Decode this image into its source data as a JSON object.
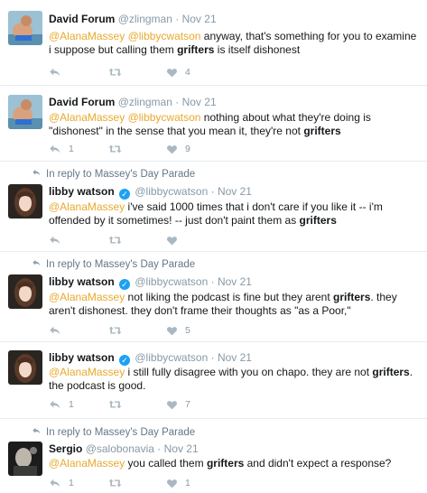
{
  "tweets": [
    {
      "name": "David Forum",
      "handle": "@zlingman",
      "dot": "·",
      "time": "Nov 21",
      "mentions": [
        "@AlanaMassey",
        "@libbycwatson"
      ],
      "text_a": " anyway, that's something for you to examine i suppose but calling them ",
      "strong": "grifters",
      "text_b": " is itself dishonest",
      "counts": {
        "reply": "",
        "retweet": "",
        "like": "4"
      }
    },
    {
      "name": "David Forum",
      "handle": "@zlingman",
      "dot": "·",
      "time": "Nov 21",
      "mentions": [
        "@AlanaMassey",
        "@libbycwatson"
      ],
      "text_a": " nothing about what they're doing is \"dishonest\" in the sense that you mean it, they're not ",
      "strong": "grifters",
      "text_b": "",
      "counts": {
        "reply": "1",
        "retweet": "",
        "like": "9"
      }
    },
    {
      "context": "In reply to Massey's Day Parade",
      "name": "libby watson",
      "handle": "@libbycwatson",
      "dot": "·",
      "time": "Nov 21",
      "mentions": [
        "@AlanaMassey"
      ],
      "text_a": " i've said 1000 times that i don't care if you like it -- i'm offended by it sometimes! -- just don't paint them as ",
      "strong": "grifters",
      "text_b": "",
      "counts": {
        "reply": "",
        "retweet": "",
        "like": ""
      }
    },
    {
      "context": "In reply to Massey's Day Parade",
      "name": "libby watson",
      "handle": "@libbycwatson",
      "dot": "·",
      "time": "Nov 21",
      "mentions": [
        "@AlanaMassey"
      ],
      "text_a": " not liking the podcast is fine but they arent ",
      "strong": "grifters",
      "text_b": ". they aren't dishonest. they don't frame their thoughts as \"as a Poor,\"",
      "counts": {
        "reply": "",
        "retweet": "",
        "like": "5"
      }
    },
    {
      "name": "libby watson",
      "handle": "@libbycwatson",
      "dot": "·",
      "time": "Nov 21",
      "mentions": [
        "@AlanaMassey"
      ],
      "text_a": " i still fully disagree with you on chapo. they are not ",
      "strong": "grifters",
      "text_b": ". the podcast is good.",
      "counts": {
        "reply": "1",
        "retweet": "",
        "like": "7"
      }
    },
    {
      "context": "In reply to Massey's Day Parade",
      "name": "Sergio",
      "handle": "@salobonavia",
      "dot": "·",
      "time": "Nov 21",
      "mentions": [
        "@AlanaMassey"
      ],
      "text_a": " you called them ",
      "strong": "grifters",
      "text_b": " and didn't expect a response?",
      "counts": {
        "reply": "1",
        "retweet": "",
        "like": "1"
      }
    }
  ],
  "colors": {
    "mention": "#e8a92e",
    "verified": "#1da1f2",
    "icon": "#aab8c2",
    "muted": "#8899a6",
    "divider": "#e6ecf0"
  },
  "icons": {
    "context": "reply-arrow-icon",
    "verified": "verified-badge-icon",
    "reply": "reply-icon",
    "retweet": "retweet-icon",
    "like": "heart-icon"
  }
}
